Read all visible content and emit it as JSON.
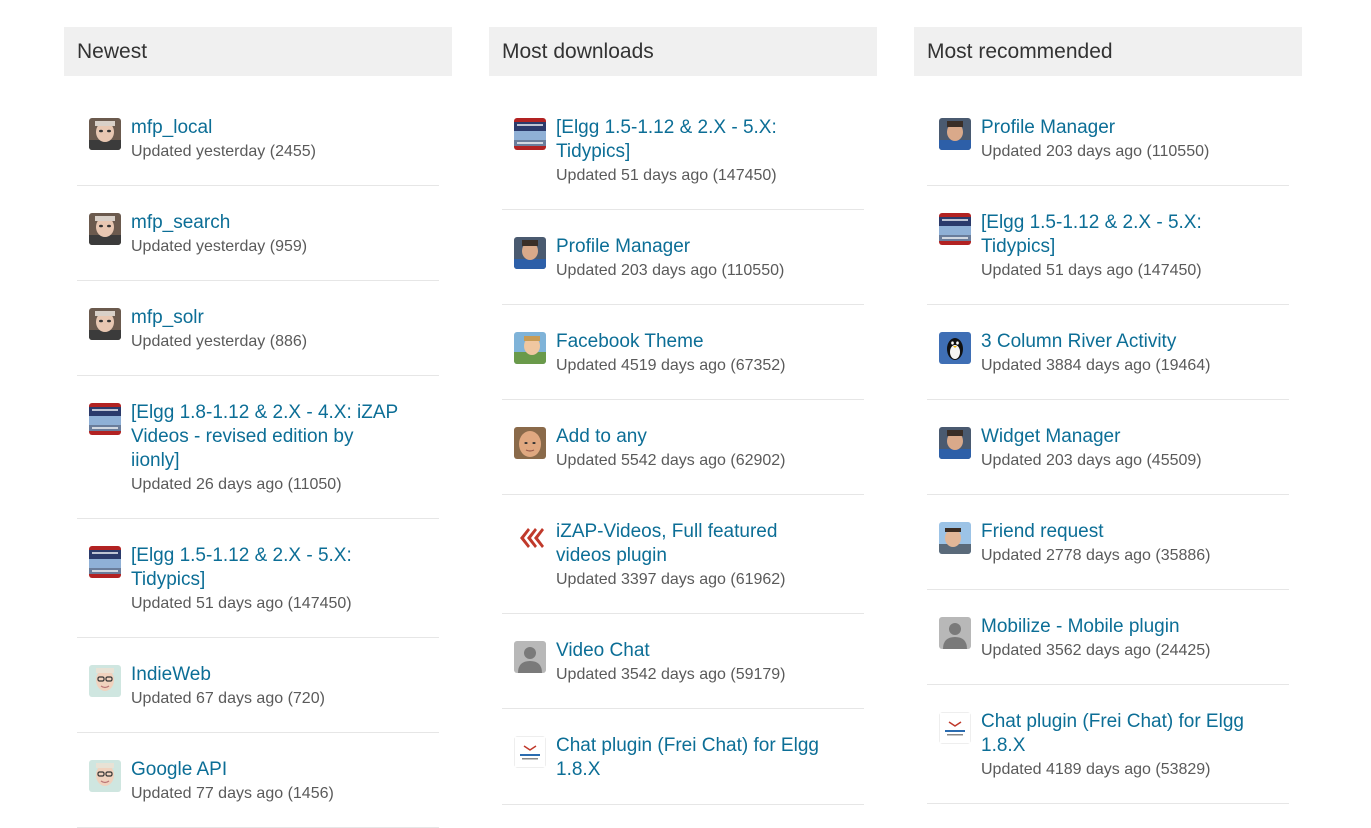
{
  "columns": [
    {
      "heading": "Newest",
      "items": [
        {
          "title": "mfp_local",
          "meta": "Updated yesterday (2455)",
          "icon": "avatar-man-icon"
        },
        {
          "title": "mfp_search",
          "meta": "Updated yesterday (959)",
          "icon": "avatar-man-icon"
        },
        {
          "title": "mfp_solr",
          "meta": "Updated yesterday (886)",
          "icon": "avatar-man-icon"
        },
        {
          "title": "[Elgg 1.8-1.12 & 2.X - 4.X: iZAP Videos - revised edition by iionly]",
          "meta": "Updated 26 days ago (11050)",
          "icon": "banner-avatar-icon"
        },
        {
          "title": "[Elgg 1.5-1.12 & 2.X - 5.X: Tidypics]",
          "meta": "Updated 51 days ago (147450)",
          "icon": "banner-avatar-icon"
        },
        {
          "title": "IndieWeb",
          "meta": "Updated 67 days ago (720)",
          "icon": "avatar-glasses-icon"
        },
        {
          "title": "Google API",
          "meta": "Updated 77 days ago (1456)",
          "icon": "avatar-glasses-icon"
        }
      ]
    },
    {
      "heading": "Most downloads",
      "items": [
        {
          "title": "[Elgg 1.5-1.12 & 2.X - 5.X: Tidypics]",
          "meta": "Updated 51 days ago (147450)",
          "icon": "banner-avatar-icon"
        },
        {
          "title": "Profile Manager",
          "meta": "Updated 203 days ago (110550)",
          "icon": "avatar-blue-shirt-icon"
        },
        {
          "title": "Facebook Theme",
          "meta": "Updated 4519 days ago (67352)",
          "icon": "avatar-outdoor-icon"
        },
        {
          "title": "Add to any",
          "meta": "Updated 5542 days ago (62902)",
          "icon": "avatar-bald-icon"
        },
        {
          "title": "iZAP-Videos, Full featured videos plugin",
          "meta": "Updated 3397 days ago (61962)",
          "icon": "izap-logo-icon"
        },
        {
          "title": "Video Chat",
          "meta": "Updated 3542 days ago (59179)",
          "icon": "default-user-icon"
        },
        {
          "title": "Chat plugin (Frei Chat) for Elgg 1.8.X",
          "meta": "",
          "icon": "freichat-logo-icon"
        }
      ]
    },
    {
      "heading": "Most recommended",
      "items": [
        {
          "title": "Profile Manager",
          "meta": "Updated 203 days ago (110550)",
          "icon": "avatar-blue-shirt-icon"
        },
        {
          "title": "[Elgg 1.5-1.12 & 2.X - 5.X: Tidypics]",
          "meta": "Updated 51 days ago (147450)",
          "icon": "banner-avatar-icon"
        },
        {
          "title": "3 Column River Activity",
          "meta": "Updated 3884 days ago (19464)",
          "icon": "tux-penguin-icon"
        },
        {
          "title": "Widget Manager",
          "meta": "Updated 203 days ago (45509)",
          "icon": "avatar-blue-shirt-icon"
        },
        {
          "title": "Friend request",
          "meta": "Updated 2778 days ago (35886)",
          "icon": "avatar-sky-icon"
        },
        {
          "title": "Mobilize - Mobile plugin",
          "meta": "Updated 3562 days ago (24425)",
          "icon": "default-user-icon"
        },
        {
          "title": "Chat plugin (Frei Chat) for Elgg 1.8.X",
          "meta": "Updated 4189 days ago (53829)",
          "icon": "freichat-logo-icon"
        }
      ]
    }
  ]
}
